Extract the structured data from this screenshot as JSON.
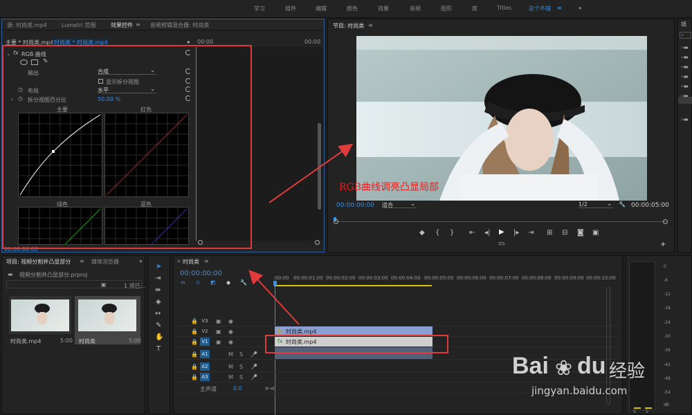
{
  "workspaces": [
    "学习",
    "组件",
    "编辑",
    "颜色",
    "效果",
    "音频",
    "图形",
    "库",
    "Titles",
    "这个不错"
  ],
  "workspace_more": "»",
  "effect_panel": {
    "tabs": [
      "源: 时尚类.mp4",
      "Lumetri 范围",
      "效果控件",
      "音频剪辑混合器: 时尚类"
    ],
    "clip_path_main": "主要 * 时尚类.mp4",
    "clip_path_seq": "时尚类 * 时尚类.mp4",
    "timecode_top": "00:00",
    "timecode_top2": "00:00",
    "fx_label": "fx",
    "effect_name": "RGB 曲线",
    "output_label": "输出",
    "output_value": "合成",
    "split_checkbox": "显示拆分视图",
    "layout_label": "布局",
    "layout_value": "水平",
    "split_pct_label": "拆分视图百分比",
    "split_pct_value": "50.00 %",
    "graph_main": "主要",
    "graph_red": "红色",
    "graph_green": "绿色",
    "graph_blue": "蓝色",
    "bottom_tc": "00:00:00:00"
  },
  "program": {
    "title": "节目: 时尚类",
    "timecode": "00:00:00:00",
    "fit": "适合",
    "quality": "1/2",
    "duration": "00:00:05:00",
    "annotation": "RGB曲线调亮凸显局部"
  },
  "project": {
    "tabs": [
      "项目: 视频分割并凸显部分",
      "媒体浏览器"
    ],
    "file": "视频分割并凸显部分.prproj",
    "count": "1 项已...",
    "items": [
      {
        "name": "时尚类.mp4",
        "duration": "5:00"
      },
      {
        "name": "时尚类",
        "duration": "5:00"
      }
    ]
  },
  "timeline": {
    "title": "时尚类",
    "timecode": "00:00:00:00",
    "ruler": [
      ":00:00",
      "00:00:01:00",
      "00:00:02:00",
      "00:00:03:00",
      "00:00:04:00",
      "00:00:05:00",
      "00:00:06:00",
      "00:00:07:00",
      "00:00:08:00",
      "00:00:09:00",
      "00:00:10:00"
    ],
    "tracks": [
      "V3",
      "V2",
      "V1",
      "A1",
      "A2",
      "A3"
    ],
    "master": "主声道",
    "master_val": "0.0",
    "clip_v2": "时尚类.mp4",
    "clip_v1": "时尚类.mp4"
  },
  "meter_ticks": [
    "0",
    "-6",
    "-12",
    "-18",
    "-24",
    "-30",
    "-36",
    "-42",
    "-48",
    "-54",
    "dB"
  ],
  "meter_labels": [
    "S",
    "S"
  ],
  "watermark": {
    "brand": "Bai",
    "brand2": "du",
    "cn": "经验",
    "url": "jingyan.baidu.com"
  }
}
